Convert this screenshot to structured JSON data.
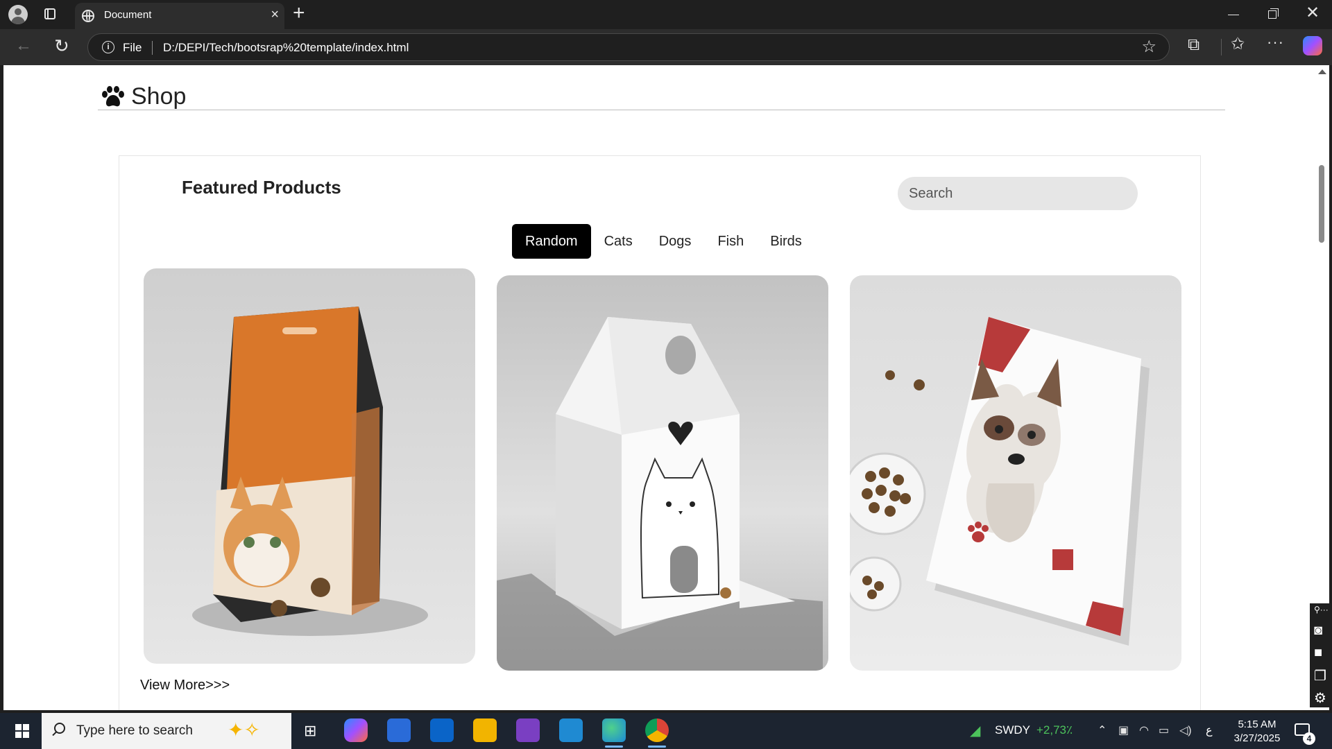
{
  "browser": {
    "tab_title": "Document",
    "new_tab_symbol": "+",
    "close_tab_symbol": "×",
    "address_prefix": "File",
    "url": "D:/DEPI/Tech/bootsrap%20template/index.html"
  },
  "page": {
    "brand_title": "Shop",
    "featured_title": "Featured Products",
    "search_placeholder": "Search",
    "filters": [
      {
        "label": "Random",
        "active": true
      },
      {
        "label": "Cats",
        "active": false
      },
      {
        "label": "Dogs",
        "active": false
      },
      {
        "label": "Fish",
        "active": false
      },
      {
        "label": "Birds",
        "active": false
      }
    ],
    "products": [
      {
        "name": "cat-food-bag",
        "alt": "Orange cat food bag"
      },
      {
        "name": "cat-food-box",
        "alt": "White cat food box"
      },
      {
        "name": "dog-food-bag",
        "alt": "White dog food bag"
      }
    ],
    "view_more": "View More>>>"
  },
  "taskbar": {
    "search_text": "Type here to search",
    "stock_ticker": "SWDY",
    "stock_change": "+2,73٪",
    "language": "ع",
    "time": "5:15 AM",
    "date": "3/27/2025",
    "notification_count": "4"
  },
  "colors": {
    "accent_black": "#000000",
    "stock_green": "#4cc25b",
    "taskbar_bg": "#1c2430"
  },
  "icons": [
    "paw-icon",
    "globe-icon",
    "info-icon",
    "star-icon",
    "extensions-icon",
    "favorites-icon",
    "more-icon",
    "windows-icon",
    "search-icon"
  ]
}
